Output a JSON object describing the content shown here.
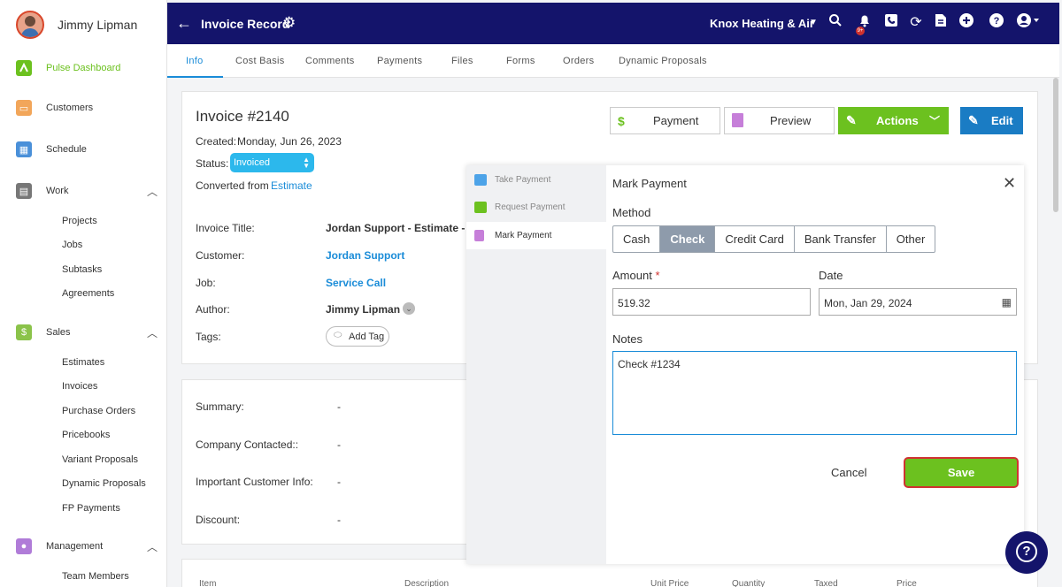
{
  "sidebar": {
    "user_name": "Jimmy Lipman",
    "items": [
      {
        "label": "Pulse Dashboard",
        "icon": "pulse-icon",
        "color": "#6cc11f"
      },
      {
        "label": "Customers",
        "icon": "customers-icon"
      },
      {
        "label": "Schedule",
        "icon": "calendar-icon"
      },
      {
        "label": "Work",
        "icon": "clipboard-icon"
      },
      {
        "label": "Sales",
        "icon": "dollar-icon"
      },
      {
        "label": "Management",
        "icon": "people-icon"
      }
    ],
    "work_sub": [
      "Projects",
      "Jobs",
      "Subtasks",
      "Agreements"
    ],
    "sales_sub": [
      "Estimates",
      "Invoices",
      "Purchase Orders",
      "Pricebooks",
      "Variant Proposals",
      "Dynamic Proposals",
      "FP Payments"
    ],
    "management_sub": [
      "Team Members"
    ]
  },
  "topbar": {
    "title": "Invoice Record",
    "company": "Knox Heating & Air",
    "badge": "9+",
    "bg_color": "#14146b"
  },
  "tabs": [
    "Info",
    "Cost Basis",
    "Comments",
    "Payments",
    "Files",
    "Forms",
    "Orders",
    "Dynamic Proposals"
  ],
  "invoice": {
    "title": "Invoice #2140",
    "created_label": "Created:",
    "created": "Monday, Jun 26, 2023",
    "status_label": "Status:",
    "status": "Invoiced",
    "converted_label": "Converted from",
    "converted_link": "Estimate",
    "fields": [
      {
        "label": "Invoice Title:",
        "value": "Jordan Support - Estimate - S"
      },
      {
        "label": "Customer:",
        "value": "Jordan Support"
      },
      {
        "label": "Job:",
        "value": "Service Call"
      },
      {
        "label": "Author:",
        "value": "Jimmy Lipman"
      },
      {
        "label": "Tags:",
        "value": "Add Tag"
      }
    ]
  },
  "header_buttons": {
    "payment": "Payment",
    "preview": "Preview",
    "actions": "Actions",
    "edit": "Edit"
  },
  "summary": [
    {
      "label": "Summary:",
      "value": "-"
    },
    {
      "label": "Company Contacted::",
      "value": "-"
    },
    {
      "label": "Important Customer Info:",
      "value": "-"
    },
    {
      "label": "Discount:",
      "value": "-"
    }
  ],
  "table_headers": [
    "Item",
    "Description",
    "Unit Price",
    "Quantity",
    "Taxed",
    "Price"
  ],
  "panel": {
    "side": [
      "Take Payment",
      "Request Payment",
      "Mark Payment"
    ],
    "title": "Mark Payment",
    "method_label": "Method",
    "methods": [
      "Cash",
      "Check",
      "Credit Card",
      "Bank Transfer",
      "Other"
    ],
    "selected_method": "Check",
    "amount_label": "Amount",
    "amount_required": "*",
    "amount": "519.32",
    "date_label": "Date",
    "date": "Mon, Jan 29, 2024",
    "notes_label": "Notes",
    "notes": "Check #1234",
    "cancel": "Cancel",
    "save": "Save"
  }
}
